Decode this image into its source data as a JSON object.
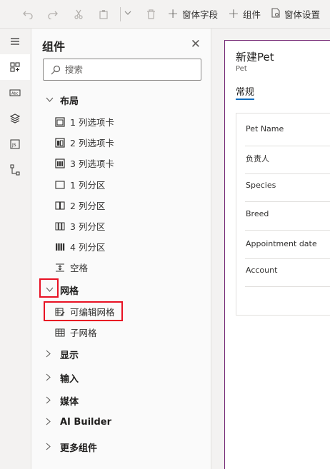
{
  "toolbar": {
    "undo_icon": "undo-icon",
    "redo_icon": "redo-icon",
    "cut_icon": "cut-icon",
    "paste_icon": "paste-icon",
    "delete_icon": "delete-icon",
    "add_field_label": "窗体字段",
    "add_component_label": "组件",
    "form_settings_label": "窗体设置"
  },
  "rail": {
    "items": [
      "menu-icon",
      "components-icon",
      "text-field-icon",
      "layers-icon",
      "js-icon",
      "tree-view-icon"
    ],
    "active": "components-icon"
  },
  "panel": {
    "title": "组件",
    "search_placeholder": "搜索",
    "groups": {
      "layout": {
        "label": "布局",
        "items": [
          "1 列选项卡",
          "2 列选项卡",
          "3 列选项卡",
          "1 列分区",
          "2 列分区",
          "3 列分区",
          "4 列分区",
          "空格"
        ]
      },
      "grid": {
        "label": "网格",
        "items": [
          "可编辑网格",
          "子网格"
        ]
      },
      "display": {
        "label": "显示"
      },
      "input": {
        "label": "输入"
      },
      "media": {
        "label": "媒体"
      },
      "ai_builder": {
        "label": "AI Builder"
      },
      "more": {
        "label": "更多组件"
      }
    }
  },
  "form": {
    "title": "新建Pet",
    "entity": "Pet",
    "tab": "常规",
    "fields": [
      "Pet Name",
      "负责人",
      "Species",
      "Breed",
      "Appointment date",
      "Account"
    ]
  },
  "colors": {
    "accent": "#0f6cbd",
    "highlight": "#e81123",
    "form_border": "#742774"
  }
}
